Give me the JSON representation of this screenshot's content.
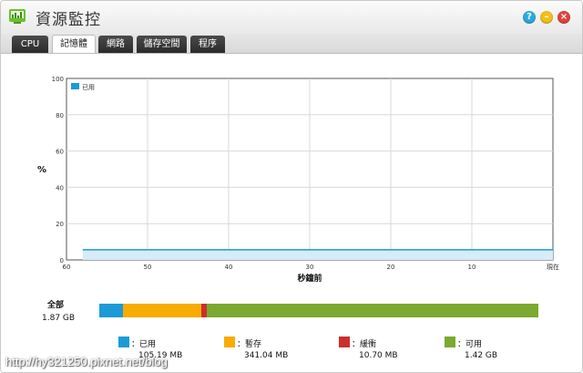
{
  "window": {
    "title": "資源監控"
  },
  "tabs": [
    {
      "label": "CPU",
      "active": false
    },
    {
      "label": "記憶體",
      "active": true
    },
    {
      "label": "網路",
      "active": false
    },
    {
      "label": "儲存空間",
      "active": false
    },
    {
      "label": "程序",
      "active": false
    }
  ],
  "colors": {
    "used": "#1a9bd7",
    "cached": "#f7ac00",
    "buffer": "#cc2e2e",
    "free": "#7aaa2f",
    "accent": "#2eaadf"
  },
  "chart_data": {
    "type": "line",
    "ylabel": "%",
    "xlabel": "秒鐘前",
    "ylim": [
      0,
      100
    ],
    "xlim": [
      60,
      0
    ],
    "x_ticks": [
      "60",
      "50",
      "40",
      "30",
      "20",
      "10",
      "現在"
    ],
    "y_ticks": [
      "0",
      "20",
      "40",
      "60",
      "80",
      "100"
    ],
    "grid": true,
    "legend_position": "top-left",
    "series": [
      {
        "name": "已用",
        "x": [
          58,
          50,
          40,
          30,
          20,
          10,
          0
        ],
        "values": [
          5.6,
          5.6,
          5.6,
          5.6,
          5.6,
          5.6,
          5.6
        ]
      }
    ]
  },
  "summary": {
    "label": "全部",
    "total": "1.87 GB",
    "segments": [
      {
        "key": "used",
        "label": "：已用",
        "value": "105.19 MB",
        "fraction": 0.0549
      },
      {
        "key": "cached",
        "label": "：暫存",
        "value": "341.04 MB",
        "fraction": 0.1781
      },
      {
        "key": "buffer",
        "label": "：緩衝",
        "value": "10.70 MB",
        "fraction": 0.0112
      },
      {
        "key": "free",
        "label": "：可用",
        "value": "1.42 GB",
        "fraction": 0.7558
      }
    ]
  },
  "watermark": "http://hy321250.pixnet.net/blog"
}
